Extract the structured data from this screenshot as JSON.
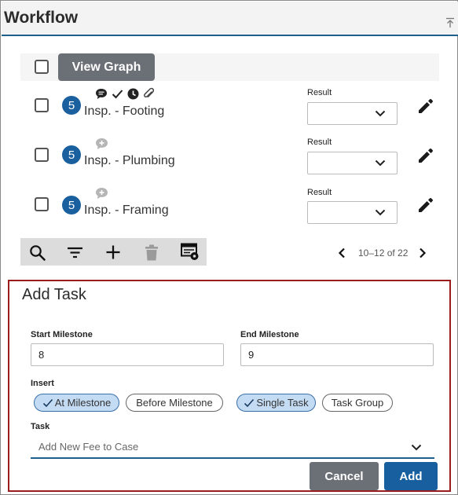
{
  "header": {
    "title": "Workflow"
  },
  "toolbar": {
    "view_graph_label": "View Graph"
  },
  "tasks": [
    {
      "badge": "5",
      "name": "Insp. - Footing",
      "result_label": "Result",
      "result_value": "",
      "icons": [
        "comment-icon",
        "check-icon",
        "clock-icon",
        "paperclip-icon"
      ]
    },
    {
      "badge": "5",
      "name": "Insp. - Plumbing",
      "result_label": "Result",
      "result_value": "",
      "icons": [
        "add-comment-icon"
      ]
    },
    {
      "badge": "5",
      "name": "Insp. - Framing",
      "result_label": "Result",
      "result_value": "",
      "icons": [
        "add-comment-icon"
      ]
    }
  ],
  "bottom_toolbar": {
    "icons": [
      "search-icon",
      "filter-icon",
      "plus-icon",
      "trash-icon",
      "column-settings-icon"
    ]
  },
  "pager": {
    "text": "10–12 of 22"
  },
  "add_task": {
    "title": "Add Task",
    "start_label": "Start Milestone",
    "start_value": "8",
    "end_label": "End Milestone",
    "end_value": "9",
    "insert_label": "Insert",
    "chips": {
      "at_milestone": "At Milestone",
      "before_milestone": "Before Milestone",
      "single_task": "Single Task",
      "task_group": "Task Group"
    },
    "task_label": "Task",
    "task_value": "Add New Fee to Case",
    "cancel_label": "Cancel",
    "add_label": "Add"
  },
  "colors": {
    "accent": "#1a5f9e",
    "panel_border": "#9b1c1c",
    "button_gray": "#6b6f76",
    "chip_selected": "#c4dbf4"
  }
}
